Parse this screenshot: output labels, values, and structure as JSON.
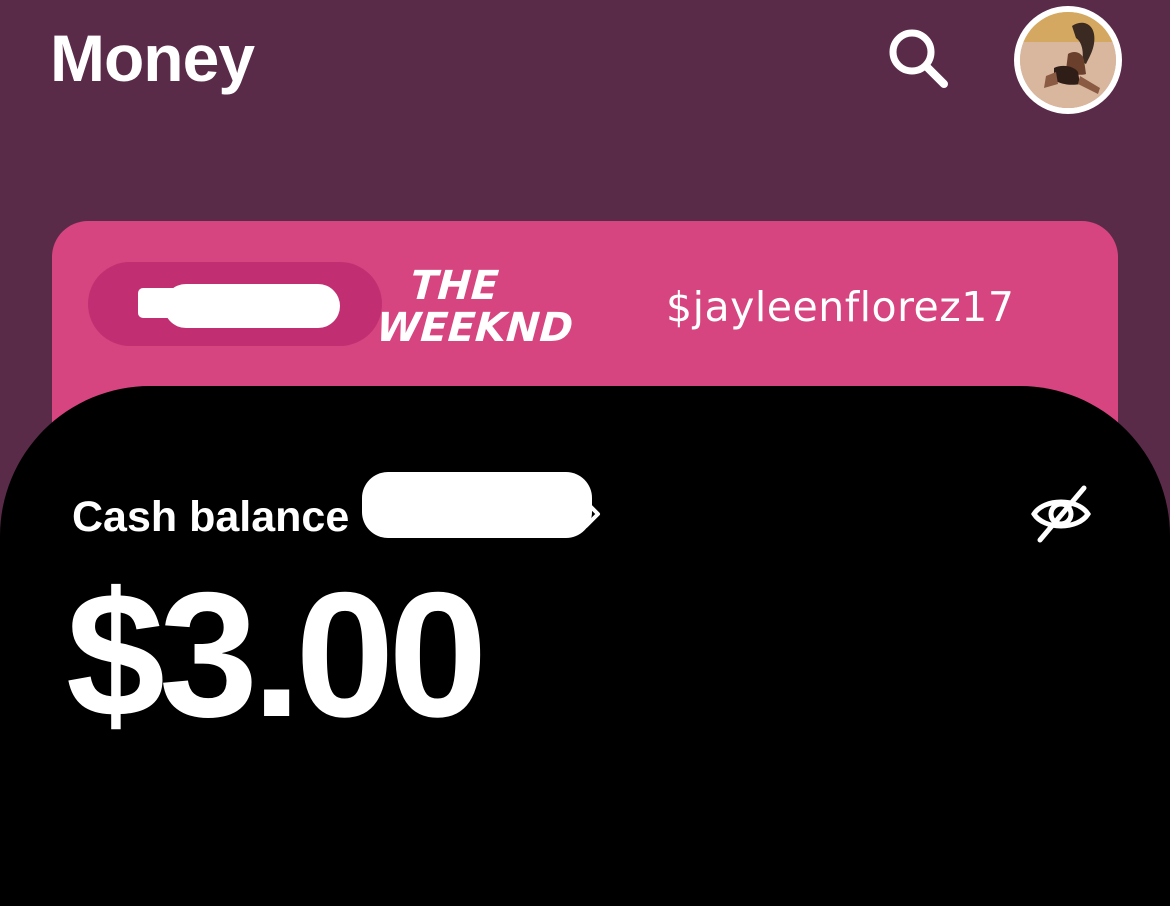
{
  "header": {
    "title": "Money",
    "search_icon": "search-icon",
    "avatar_icon": "profile-avatar"
  },
  "card": {
    "color": "#d6457f",
    "selector_icon": "card-icon",
    "brand_line1": "THE",
    "brand_line2": "WEEKND",
    "cashtag": "$jayleenflorez17"
  },
  "balance": {
    "label": "Cash balance",
    "amount": "$3.00",
    "chevron_icon": "chevron-right-icon",
    "visibility_icon": "eye-slash-icon"
  },
  "colors": {
    "background": "#5a2b48",
    "panel": "#000000",
    "accent_pill": "#c12f72"
  }
}
